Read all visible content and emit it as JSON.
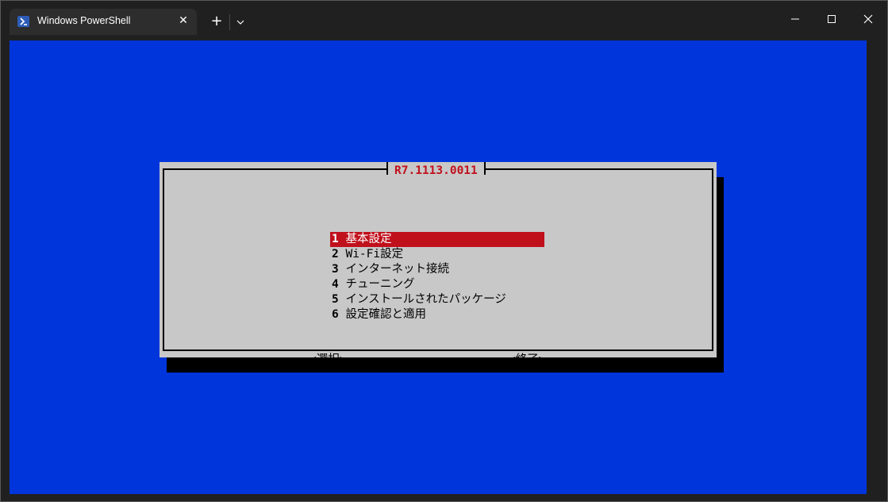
{
  "window": {
    "tab_title": "Windows PowerShell",
    "tab_close_glyph": "✕",
    "new_tab_glyph": "+",
    "tab_icon": "powershell-icon"
  },
  "dialog": {
    "title": "R7.1113.0011",
    "menu": [
      {
        "num": "1",
        "label": " 基本設定",
        "selected": true
      },
      {
        "num": "2",
        "label": " Wi-Fi設定",
        "selected": false
      },
      {
        "num": "3",
        "label": " インターネット接続",
        "selected": false
      },
      {
        "num": "4",
        "label": " チューニング",
        "selected": false
      },
      {
        "num": "5",
        "label": " インストールされたパッケージ",
        "selected": false
      },
      {
        "num": "6",
        "label": " 設定確認と適用",
        "selected": false
      }
    ],
    "select_button": "<選択>",
    "exit_button": "<終了>"
  },
  "colors": {
    "terminal_bg": "#0035dc",
    "dialog_bg": "#c8c8c8",
    "accent": "#c0101c"
  }
}
